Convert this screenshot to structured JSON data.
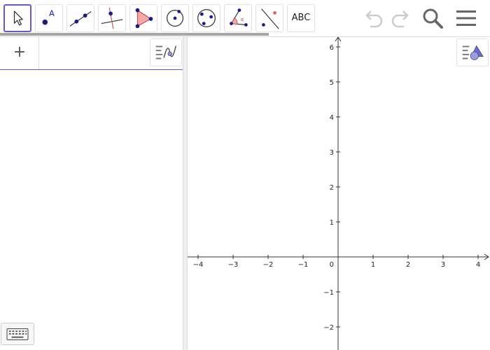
{
  "toolbar": {
    "tools": [
      {
        "name": "move-tool",
        "icon": "arrow-cursor-icon",
        "active": true
      },
      {
        "name": "point-tool",
        "icon": "point-icon",
        "active": false
      },
      {
        "name": "line-tool",
        "icon": "line-icon",
        "active": false
      },
      {
        "name": "perpendicular-line-tool",
        "icon": "perpendicular-line-icon",
        "active": false
      },
      {
        "name": "polygon-tool",
        "icon": "polygon-icon",
        "active": false
      },
      {
        "name": "circle-center-point-tool",
        "icon": "circle-center-icon",
        "active": false
      },
      {
        "name": "circle-three-points-tool",
        "icon": "circle-three-points-icon",
        "active": false
      },
      {
        "name": "angle-tool",
        "icon": "angle-icon",
        "active": false
      },
      {
        "name": "reflect-tool",
        "icon": "reflect-icon",
        "active": false
      },
      {
        "name": "text-tool",
        "label": "ABC",
        "active": false
      }
    ],
    "undo_icon": "undo-icon",
    "redo_icon": "redo-icon",
    "search_icon": "search-icon",
    "menu_icon": "hamburger-menu-icon"
  },
  "algebra": {
    "plus_label": "+",
    "input_value": "",
    "input_placeholder": "",
    "style_icon": "algebra-style-icon",
    "keyboard_icon": "keyboard-icon"
  },
  "graphics": {
    "style_icon": "graphics-style-icon",
    "x_ticks": [
      "−4",
      "−3",
      "−2",
      "−1",
      "1",
      "2",
      "3",
      "4"
    ],
    "y_ticks_positive": [
      "1",
      "2",
      "3",
      "4",
      "5",
      "6"
    ],
    "y_ticks_negative": [
      "−1",
      "−2"
    ],
    "origin_label": "0",
    "x_range": [
      -4.3,
      4.3
    ],
    "y_range": [
      -2.6,
      6.3
    ]
  },
  "colors": {
    "accent": "#6557d2",
    "point": "#1a1a8c",
    "polygon_fill": "#f4a7a7",
    "polygon_stroke": "#c44d4d",
    "icon_gray": "#999999"
  }
}
